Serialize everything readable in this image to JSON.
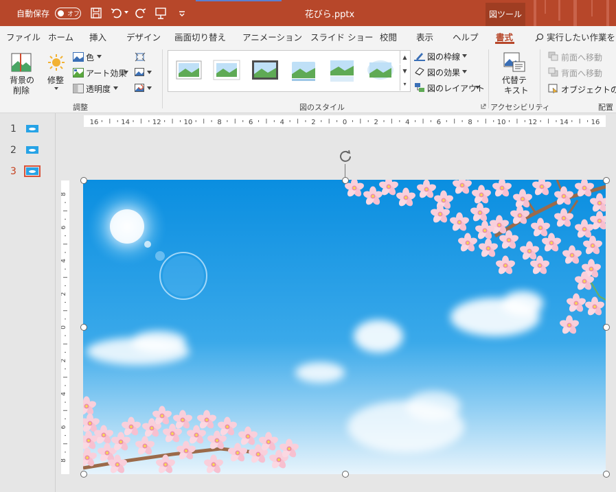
{
  "titlebar": {
    "autosave_label": "自動保存",
    "autosave_state": "オフ",
    "document_title": "花びら.pptx",
    "context_tab": "図ツール"
  },
  "tabs": [
    {
      "label": "ファイル"
    },
    {
      "label": "ホーム"
    },
    {
      "label": "挿入"
    },
    {
      "label": "デザイン"
    },
    {
      "label": "画面切り替え"
    },
    {
      "label": "アニメーション"
    },
    {
      "label": "スライド ショー"
    },
    {
      "label": "校閲"
    },
    {
      "label": "表示"
    },
    {
      "label": "ヘルプ"
    },
    {
      "label": "書式",
      "active": true
    }
  ],
  "tell_me": "実行したい作業を",
  "ribbon": {
    "remove_bg_line1": "背景の",
    "remove_bg_line2": "削除",
    "corrections": "修整",
    "color": "色",
    "artistic_effects": "アート効果",
    "transparency": "透明度",
    "group_adjust": "調整",
    "picture_border": "図の枠線",
    "picture_effects": "図の効果",
    "picture_layout": "図のレイアウト",
    "group_styles": "図のスタイル",
    "alt_text_line1": "代替テ",
    "alt_text_line2": "キスト",
    "group_accessibility": "アクセシビリティ",
    "bring_forward": "前面へ移動",
    "send_backward": "背面へ移動",
    "selection_pane": "オブジェクトの選択",
    "group_arrange": "配置"
  },
  "slides": [
    {
      "number": "1",
      "selected": false
    },
    {
      "number": "2",
      "selected": false
    },
    {
      "number": "3",
      "selected": true
    }
  ],
  "ruler_h_labels": [
    "16",
    "14",
    "12",
    "10",
    "8",
    "6",
    "4",
    "2",
    "0",
    "2",
    "4",
    "6",
    "8",
    "10",
    "12",
    "14",
    "16"
  ],
  "ruler_v_labels": [
    "8",
    "6",
    "4",
    "2",
    "0",
    "2",
    "4",
    "6",
    "8"
  ],
  "colors": {
    "accent": "#b7472a",
    "sky_top": "#0a8ee0",
    "sky_bottom": "#e7f4fc",
    "blossom": "#f7c6d4"
  }
}
